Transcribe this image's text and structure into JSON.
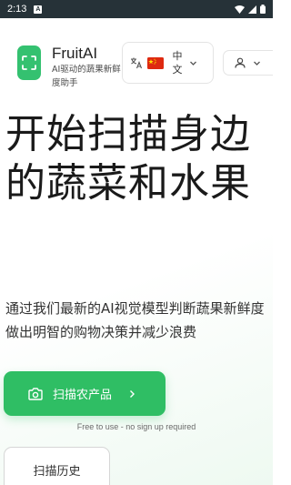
{
  "status_bar": {
    "time": "2:13",
    "notification_letter": "A"
  },
  "header": {
    "brand_name": "FruitAI",
    "brand_subtitle": "AI驱动的蔬果新鲜度助手",
    "language": {
      "label": "中文",
      "flag": "china-flag-icon"
    },
    "account_icon": "person-icon"
  },
  "hero": {
    "title": "开始扫描身边的蔬菜和水果",
    "description": "通过我们最新的AI视觉模型判断蔬果新鲜度 做出明智的购物决策并减少浪费"
  },
  "actions": {
    "scan_button": "扫描农产品",
    "free_note": "Free to use - no sign up required",
    "history_button": "扫描历史"
  },
  "colors": {
    "accent": "#2fbe64",
    "status_bar": "#263238"
  }
}
